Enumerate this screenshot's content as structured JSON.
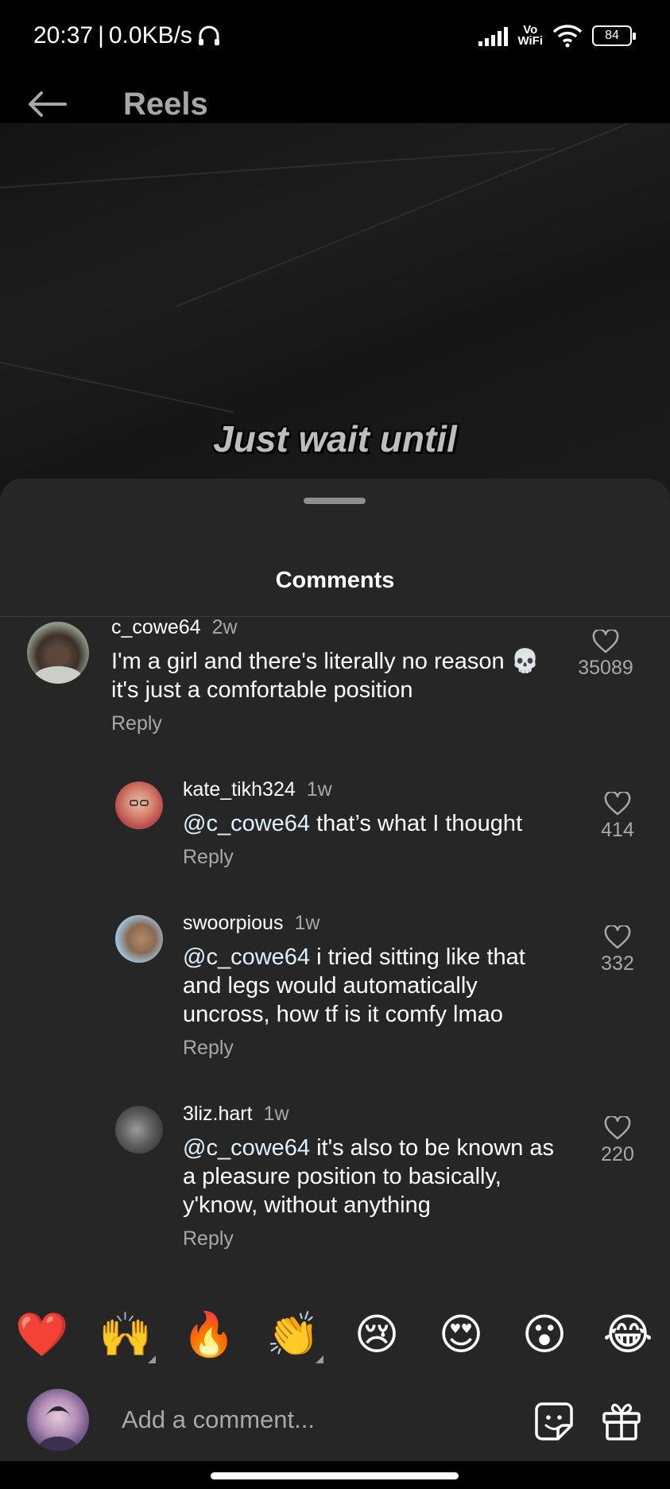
{
  "status_bar": {
    "time": "20:37",
    "separator": "|",
    "net_speed": "0.0KB/s",
    "vowifi_top": "Vo",
    "vowifi_bottom": "WiFi",
    "battery": "84"
  },
  "header": {
    "title": "Reels"
  },
  "video": {
    "caption": "Just wait until"
  },
  "comments_sheet": {
    "title": "Comments",
    "comments": [
      {
        "username": "c_cowe64",
        "age": "2w",
        "text": "I'm a girl and there's literally no reason 💀 it's just a comfortable position",
        "reply_label": "Reply",
        "likes": "35089"
      },
      {
        "username": "kate_tikh324",
        "age": "1w",
        "mention": "@c_cowe64",
        "text": " that’s what I thought",
        "reply_label": "Reply",
        "likes": "414"
      },
      {
        "username": "swoorpious",
        "age": "1w",
        "mention": "@c_cowe64",
        "text": " i tried sitting like that and legs would automatically uncross, how tf is it comfy lmao",
        "reply_label": "Reply",
        "likes": "332"
      },
      {
        "username": "3liz.hart",
        "age": "1w",
        "mention": "@c_cowe64",
        "text": " it's also to be known as a pleasure position to basically, y'know, without anything",
        "reply_label": "Reply",
        "likes": "220"
      }
    ]
  },
  "emoji_bar": {
    "emojis": [
      "❤️",
      "🙌",
      "🔥",
      "👏",
      "😢",
      "😍",
      "😮",
      "😂"
    ]
  },
  "comment_input": {
    "placeholder": "Add a comment..."
  },
  "icons": {
    "back": "back-arrow-icon",
    "like": "heart-outline-icon",
    "sticker": "sticker-icon",
    "gift": "gift-icon"
  },
  "colors": {
    "sheet_background": "#262626",
    "secondary_text": "#a8a8a8",
    "mention": "#e0f1ff"
  }
}
